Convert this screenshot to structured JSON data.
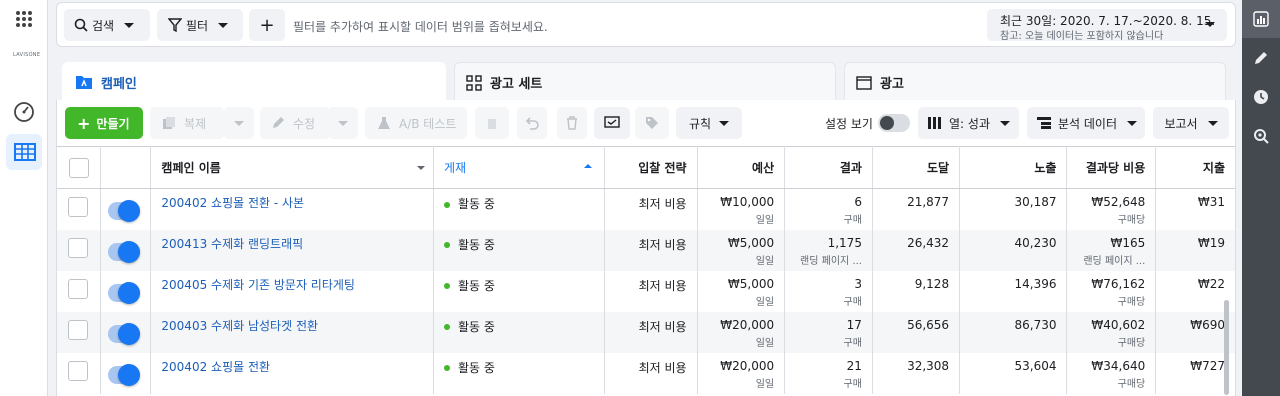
{
  "left_nav": {
    "brand": "LAVISONE"
  },
  "top_bar": {
    "search_label": "검색",
    "filter_label": "필터",
    "add_label": "+",
    "filter_hint": "필터를 추가하여 표시할 데이터 범위를 좁혀보세요.",
    "date_range": "최근 30일: 2020. 7. 17.~2020. 8. 15.",
    "date_note": "참고: 오늘 데이터는 포함하지 않습니다"
  },
  "tabs": [
    {
      "label": "캠페인",
      "selected": true
    },
    {
      "label": "광고 세트",
      "selected": false
    },
    {
      "label": "광고",
      "selected": false
    }
  ],
  "toolbar": {
    "create": "만들기",
    "duplicate": "복제",
    "edit": "수정",
    "ab_test": "A/B 테스트",
    "rules": "규칙",
    "view_setup": "설정 보기",
    "columns": "열: 성과",
    "breakdown": "분석 데이터",
    "reports": "보고서"
  },
  "table": {
    "headers": {
      "name": "캠페인 이름",
      "delivery": "게재",
      "bid": "입찰 전략",
      "budget": "예산",
      "results": "결과",
      "reach": "도달",
      "impressions": "노출",
      "cost_per_result": "결과당 비용",
      "spent": "지출"
    },
    "rows": [
      {
        "name": "200402 쇼핑몰 전환 - 사본",
        "status": "활동 중",
        "bid": "최저 비용",
        "budget": "₩10,000",
        "budget_sub": "일일",
        "results": "6",
        "results_sub": "구매",
        "reach": "21,877",
        "impressions": "30,187",
        "cpr": "₩52,648",
        "cpr_sub": "구매당",
        "spent": "₩31"
      },
      {
        "name": "200413 수제화 랜딩트래픽",
        "status": "활동 중",
        "bid": "최저 비용",
        "budget": "₩5,000",
        "budget_sub": "일일",
        "results": "1,175",
        "results_sub": "랜딩 페이지 ...",
        "reach": "26,432",
        "impressions": "40,230",
        "cpr": "₩165",
        "cpr_sub": "랜딩 페이지 ...",
        "spent": "₩19"
      },
      {
        "name": "200405 수제화 기존 방문자 리타게팅",
        "status": "활동 중",
        "bid": "최저 비용",
        "budget": "₩5,000",
        "budget_sub": "일일",
        "results": "3",
        "results_sub": "구매",
        "reach": "9,128",
        "impressions": "14,396",
        "cpr": "₩76,162",
        "cpr_sub": "구매당",
        "spent": "₩22"
      },
      {
        "name": "200403 수제화 남성타겟 전환",
        "status": "활동 중",
        "bid": "최저 비용",
        "budget": "₩20,000",
        "budget_sub": "일일",
        "results": "17",
        "results_sub": "구매",
        "reach": "56,656",
        "impressions": "86,730",
        "cpr": "₩40,602",
        "cpr_sub": "구매당",
        "spent": "₩690"
      },
      {
        "name": "200402 쇼핑몰 전환",
        "status": "활동 중",
        "bid": "최저 비용",
        "budget": "₩20,000",
        "budget_sub": "일일",
        "results": "21",
        "results_sub": "구매",
        "reach": "32,308",
        "impressions": "53,604",
        "cpr": "₩34,640",
        "cpr_sub": "구매당",
        "spent": "₩727"
      }
    ]
  }
}
